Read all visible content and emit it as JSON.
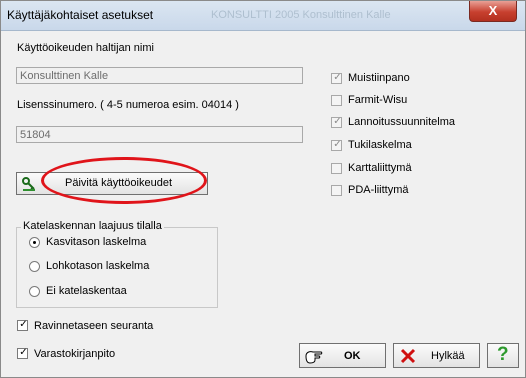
{
  "window": {
    "title": "Käyttäjäkohtaiset asetukset",
    "ghost_title": "KONSULTTI 2005 Konsulttinen Kalle",
    "close_label": "X"
  },
  "license": {
    "holder_label": "Käyttöoikeuden haltijan nimi",
    "holder_value": "Konsulttinen Kalle",
    "number_label": "Lisenssinumero. ( 4-5 numeroa esim. 04014 )",
    "number_value": "51804",
    "update_button": "Päivitä käyttöoikeudet"
  },
  "modules": [
    {
      "label": "Muistiinpano",
      "checked": true
    },
    {
      "label": "Farmit-Wisu",
      "checked": false
    },
    {
      "label": "Lannoitussuunnitelma",
      "checked": true
    },
    {
      "label": "Tukilaskelma",
      "checked": true
    },
    {
      "label": "Karttaliittymä",
      "checked": false
    },
    {
      "label": "PDA-liittymä",
      "checked": false
    }
  ],
  "calc_group": {
    "title": "Katelaskennan laajuus tilalla",
    "options": [
      {
        "label": "Kasvitason laskelma",
        "selected": true
      },
      {
        "label": "Lohkotason laskelma",
        "selected": false
      },
      {
        "label": "Ei katelaskentaa",
        "selected": false
      }
    ]
  },
  "options": {
    "nutrient_label": "Ravinnetaseen seuranta",
    "nutrient_checked": true,
    "stock_label": "Varastokirjanpito",
    "stock_checked": true
  },
  "buttons": {
    "ok": "OK",
    "cancel": "Hylkää",
    "help": "?"
  },
  "colors": {
    "highlight_oval": "#e0141a",
    "close_button": "#c7402f",
    "help_icon": "#2e9a2e"
  }
}
